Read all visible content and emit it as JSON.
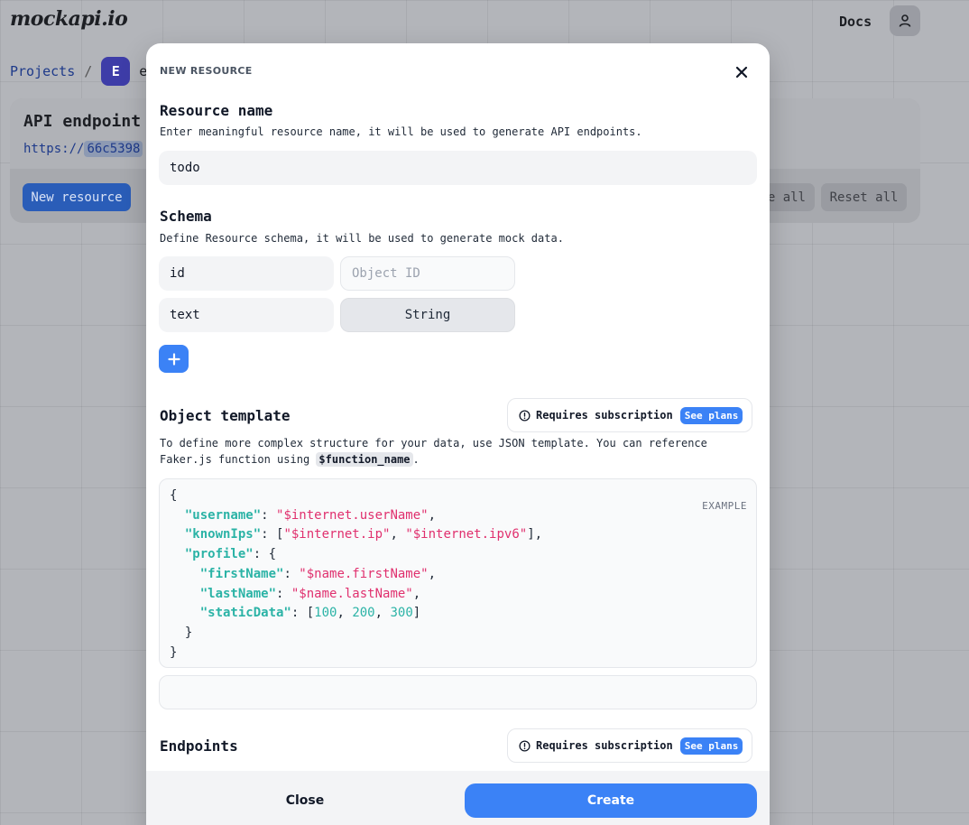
{
  "app": {
    "logo": "mockapi.io",
    "docs_label": "Docs",
    "user_icon": "user-icon"
  },
  "breadcrumb": {
    "projects_label": "Projects",
    "separator": "/",
    "project_initial": "E",
    "project_name_visible": "e"
  },
  "endpoint_card": {
    "title": "API endpoint",
    "url_prefix": "https://",
    "url_hash_visible": "66c5398",
    "new_resource_label": "New resource",
    "generate_all_label_visible": "e all",
    "reset_all_label": "Reset all"
  },
  "modal": {
    "header_label": "NEW RESOURCE",
    "close_icon": "close-icon",
    "resource_name": {
      "title": "Resource name",
      "description": "Enter meaningful resource name, it will be used to generate API endpoints.",
      "value": "todo"
    },
    "schema": {
      "title": "Schema",
      "description": "Define Resource schema, it will be used to generate mock data.",
      "fields": [
        {
          "name": "id",
          "type_placeholder": "Object ID"
        },
        {
          "name": "text",
          "type": "String"
        }
      ],
      "add_icon": "plus-icon"
    },
    "object_template": {
      "title": "Object template",
      "badge_label": "Requires subscription",
      "badge_link": "See plans",
      "description_part1": "To define more complex structure for your data, use JSON template. You can reference Faker.js function using ",
      "description_code": "$function_name",
      "description_part2": ".",
      "example_tag": "EXAMPLE",
      "code": {
        "k_username": "\"username\"",
        "v_username": "\"$internet.userName\"",
        "k_knownIps": "\"knownIps\"",
        "v_ip": "\"$internet.ip\"",
        "v_ipv6": "\"$internet.ipv6\"",
        "k_profile": "\"profile\"",
        "k_firstName": "\"firstName\"",
        "v_firstName": "\"$name.firstName\"",
        "k_lastName": "\"lastName\"",
        "v_lastName": "\"$name.lastName\"",
        "k_staticData": "\"staticData\"",
        "n1": "100",
        "n2": "200",
        "n3": "300"
      }
    },
    "endpoints": {
      "title": "Endpoints",
      "badge_label": "Requires subscription",
      "badge_link": "See plans"
    },
    "footer": {
      "close_label": "Close",
      "create_label": "Create"
    }
  },
  "colors": {
    "primary": "#3b82f6",
    "json_key": "#2bb3a6",
    "json_string": "#e0306e"
  }
}
